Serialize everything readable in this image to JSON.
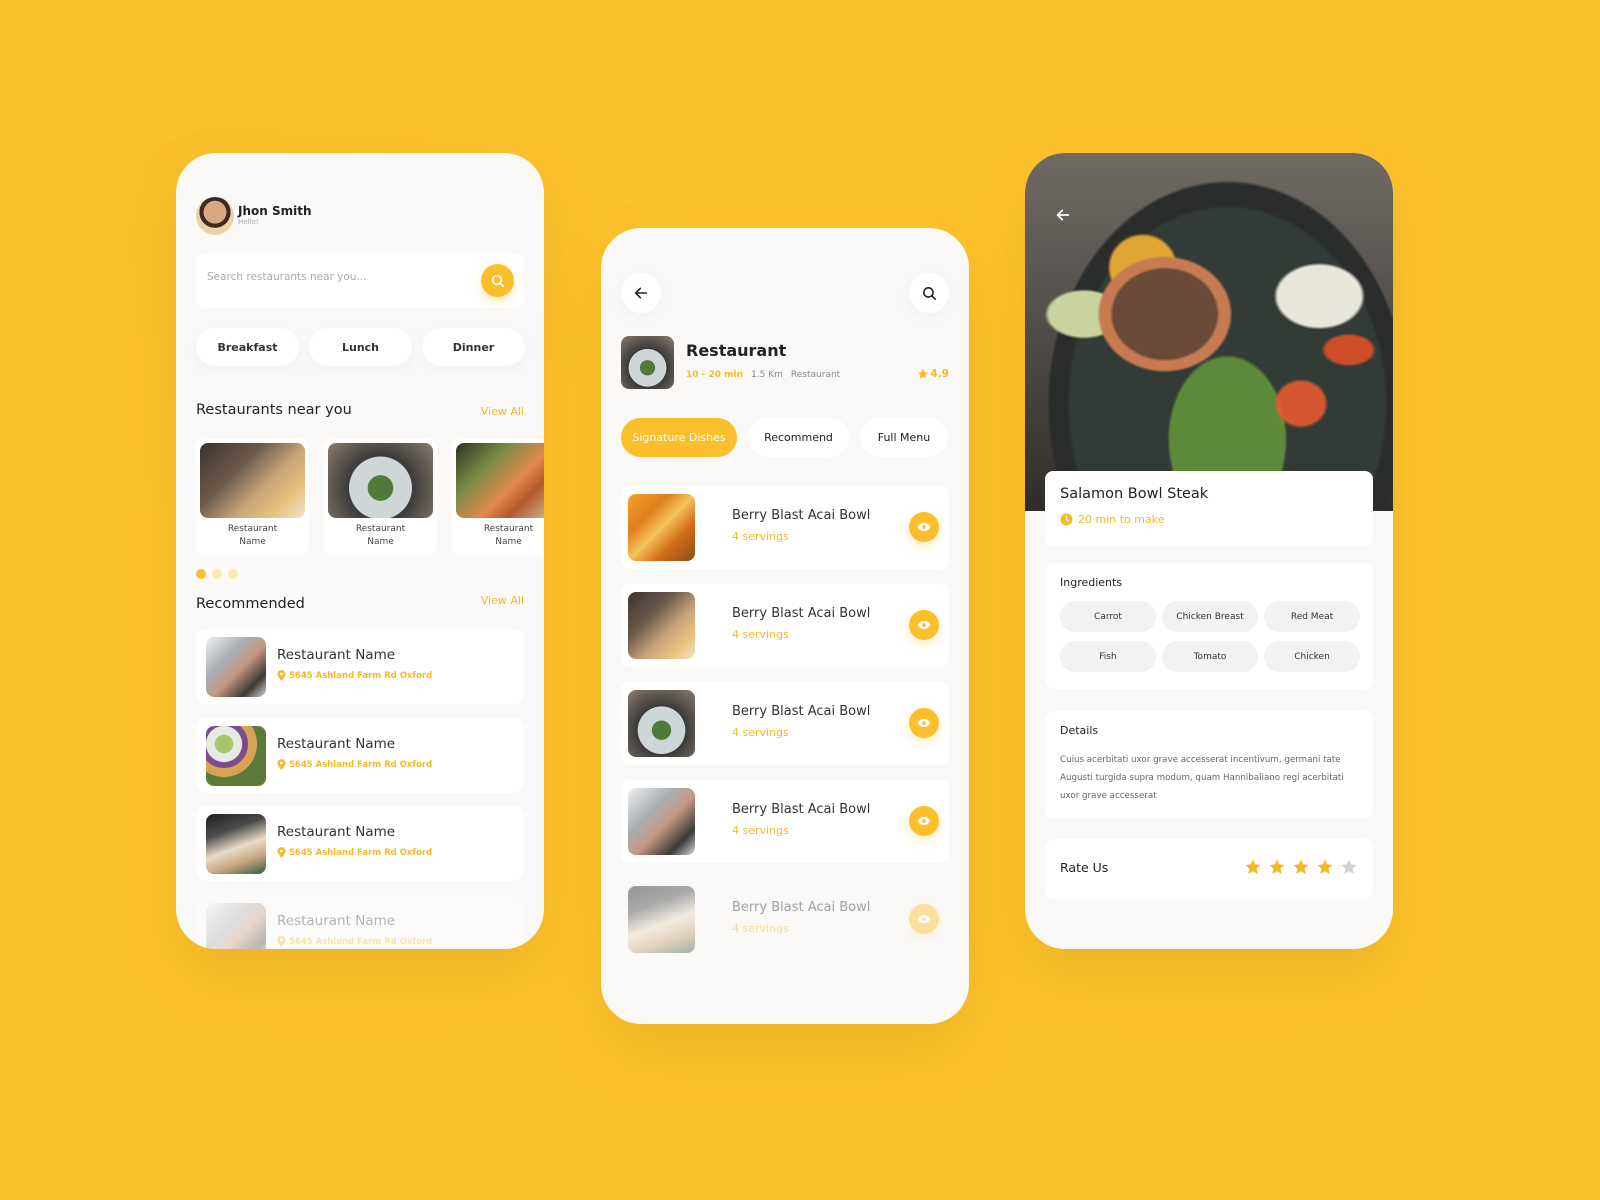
{
  "theme": {
    "accent": "#fbbf2c",
    "background": "#fcc22b",
    "card": "#ffffff",
    "screen": "#faf9f7"
  },
  "screen1": {
    "user": {
      "name": "Jhon Smith",
      "greeting": "Hello!",
      "avatar_icon": "user-avatar"
    },
    "search": {
      "placeholder": "Search restaurants near you...",
      "value": "",
      "icon": "search-icon"
    },
    "meal_filters": [
      "Breakfast",
      "Lunch",
      "Dinner"
    ],
    "near_you": {
      "title": "Restaurants near you",
      "view_all": "View All",
      "items": [
        {
          "line1": "Restaurant",
          "line2": "Name"
        },
        {
          "line1": "Restaurant",
          "line2": "Name"
        },
        {
          "line1": "Restaurant",
          "line2": "Name"
        }
      ],
      "carousel_pages": 3,
      "carousel_active": 1
    },
    "recommended": {
      "title": "Recommended",
      "view_all": "View All",
      "items": [
        {
          "name": "Restaurant Name",
          "address": "5645 Ashland Farm Rd Oxford"
        },
        {
          "name": "Restaurant Name",
          "address": "5645 Ashland Farm Rd Oxford"
        },
        {
          "name": "Restaurant Name",
          "address": "5645 Ashland Farm Rd Oxford"
        },
        {
          "name": "Restaurant Name",
          "address": "5645 Ashland Farm Rd Oxford"
        }
      ]
    }
  },
  "screen2": {
    "restaurant": {
      "title": "Restaurant",
      "time": "10 - 20 min",
      "distance": "1.5 Km",
      "type": "Restaurant",
      "rating": "4.9"
    },
    "tabs": [
      {
        "label": "Signature Dishes",
        "active": true
      },
      {
        "label": "Recommend",
        "active": false
      },
      {
        "label": "Full Menu",
        "active": false
      }
    ],
    "dishes": [
      {
        "name": "Berry Blast Acai Bowl",
        "servings": "4 servings"
      },
      {
        "name": "Berry Blast Acai Bowl",
        "servings": "4 servings"
      },
      {
        "name": "Berry Blast Acai Bowl",
        "servings": "4 servings"
      },
      {
        "name": "Berry Blast Acai Bowl",
        "servings": "4 servings"
      },
      {
        "name": "Berry Blast Acai Bowl",
        "servings": "4 servings"
      }
    ]
  },
  "screen3": {
    "dish": {
      "title": "Salamon Bowl Steak",
      "time": "20 min to make"
    },
    "ingredients": {
      "title": "Ingredients",
      "items": [
        "Carrot",
        "Chicken Breast",
        "Red Meat",
        "Fish",
        "Tomato",
        "Chicken"
      ]
    },
    "details": {
      "title": "Details",
      "text": "Cuius acerbitati uxor grave accesserat incentivum, germani tate Augusti turgida supra modum, quam Hannibaliano regi acerbitati uxor grave accesserat"
    },
    "rate": {
      "label": "Rate Us",
      "value": 4,
      "max": 5
    }
  }
}
